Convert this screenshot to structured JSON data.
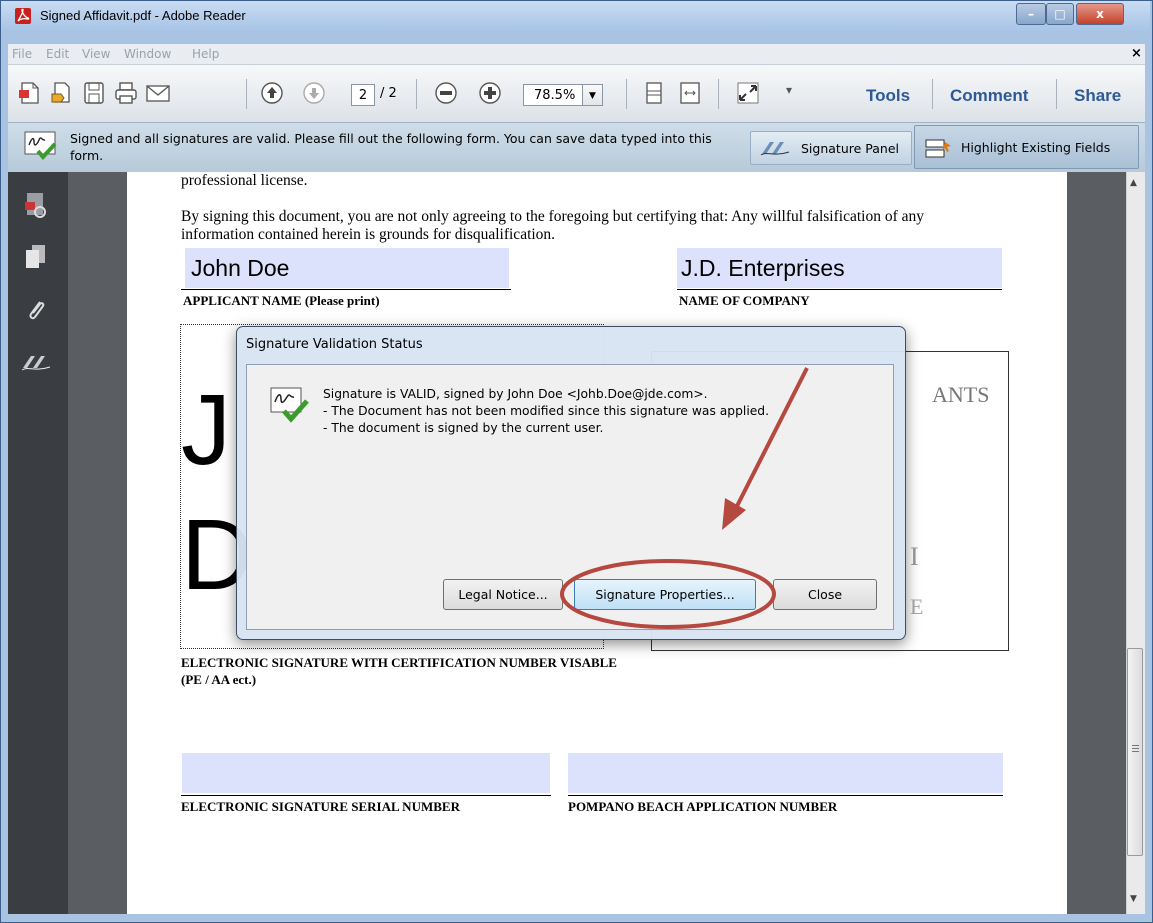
{
  "window": {
    "title": "Signed Affidavit.pdf - Adobe Reader",
    "controls": {
      "minimize": "–",
      "maximize": "□",
      "close": "x"
    }
  },
  "menu": {
    "items": [
      "File",
      "Edit",
      "View",
      "Window",
      "Help"
    ],
    "close": "×"
  },
  "toolbar": {
    "page_current": "2",
    "page_total": "/ 2",
    "zoom": "78.5%",
    "right": [
      "Tools",
      "Comment",
      "Share"
    ]
  },
  "message_bar": {
    "text": "Signed and all signatures are valid.  Please fill out the following form. You can save data typed into this form.",
    "signature_panel": "Signature Panel",
    "highlight_fields": "Highlight Existing Fields"
  },
  "document": {
    "line_top": "professional license.",
    "paragraph": "By signing this document, you are not only agreeing to the foregoing but certifying that: Any willful falsification of any information contained herein is grounds for disqualification.",
    "applicant_name_value": "John Doe",
    "company_value": "J.D. Enterprises",
    "applicant_name_label": "APPLICANT NAME (Please print)",
    "company_label": "NAME OF COMPANY",
    "signature_big": [
      "J",
      "D"
    ],
    "stamp_partial": [
      "ANTS",
      "I",
      "E"
    ],
    "signature_label": "ELECTRONIC SIGNATURE WITH CERTIFICATION NUMBER VISABLE (PE / AA ect.)",
    "serial_label": "ELECTRONIC SIGNATURE SERIAL NUMBER",
    "application_label": "POMPANO BEACH APPLICATION NUMBER"
  },
  "dialog": {
    "title": "Signature Validation Status",
    "lines": [
      "Signature is VALID, signed by John Doe <Johb.Doe@jde.com>.",
      "- The Document has not been modified since this signature was applied.",
      "- The document is signed by the current user."
    ],
    "buttons": {
      "legal": "Legal Notice...",
      "properties": "Signature Properties...",
      "close": "Close"
    }
  },
  "colors": {
    "annotation": "#b5483f",
    "form_field": "#dde2fc",
    "accent": "#2d5a94"
  }
}
